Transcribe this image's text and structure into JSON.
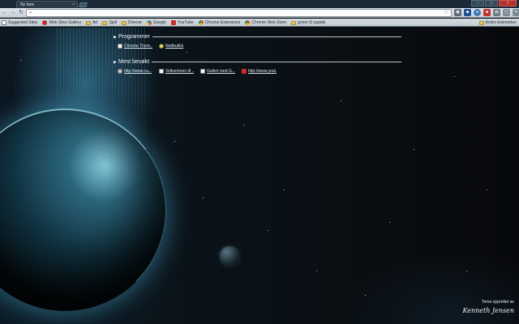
{
  "window": {
    "tab_title": "Ny fane",
    "tab_close": "×",
    "controls": [
      "–",
      "□",
      "×"
    ]
  },
  "toolbar": {
    "back_icon": "arrow-left-icon",
    "forward_icon": "arrow-right-icon",
    "reload_icon": "reload-icon",
    "back_glyph": "←",
    "forward_glyph": "→",
    "reload_glyph": "↻",
    "omnibox_value": "",
    "star_glyph": "☆"
  },
  "bookmarks": {
    "items": [
      {
        "label": "Suggested Sites",
        "icon": "page"
      },
      {
        "label": "Web Slice Gallery",
        "icon": "red"
      },
      {
        "label": "Art",
        "icon": "folder"
      },
      {
        "label": "Spill",
        "icon": "folder"
      },
      {
        "label": "Diverse",
        "icon": "folder"
      },
      {
        "label": "Google",
        "icon": "google"
      },
      {
        "label": "YouTube",
        "icon": "yt"
      },
      {
        "label": "Chrome Extensions",
        "icon": "ws"
      },
      {
        "label": "Chrome Web Store",
        "icon": "ws"
      },
      {
        "label": "greier til opptak",
        "icon": "folder"
      }
    ],
    "other": "Andre bokmerker"
  },
  "sections": {
    "apps": {
      "title": "Programmer",
      "tiles": [
        {
          "label": "Chrome Them...",
          "icon": "page"
        },
        {
          "label": "Nettbutikk",
          "icon": "yellow"
        }
      ]
    },
    "most_visited": {
      "title": "Mest besøkt",
      "tiles": [
        {
          "label": "http://www.ca...",
          "icon": "cam"
        },
        {
          "label": "Velkommen til ...",
          "icon": "page"
        },
        {
          "label": "Galleri med G...",
          "icon": "page"
        },
        {
          "label": "http://www.yout...",
          "icon": "yt"
        }
      ]
    }
  },
  "theme_credit": {
    "text": "Tema opprettet av",
    "signature": "Kenneth Jensen"
  },
  "colors": {
    "accent": "#4aa9d0",
    "close_button": "#b3322a"
  }
}
